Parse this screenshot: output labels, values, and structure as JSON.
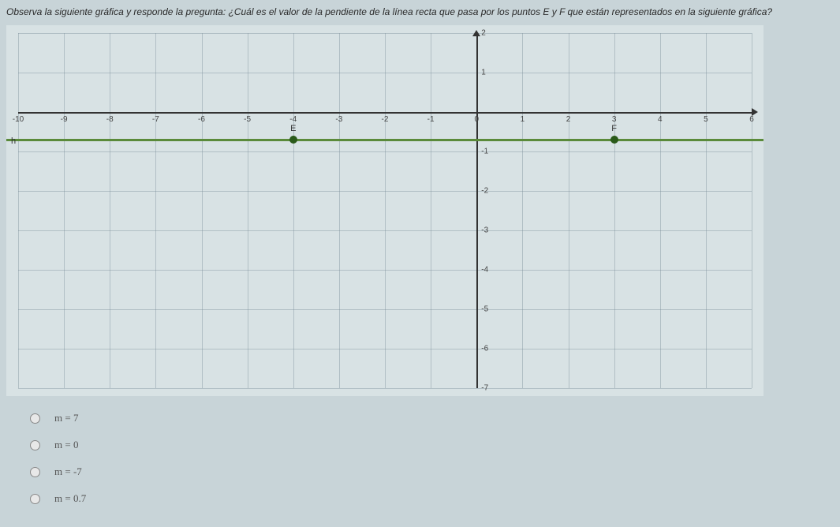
{
  "question": "Observa la siguiente gráfica y responde la pregunta: ¿Cuál es el valor de la pendiente de la línea recta que pasa por los puntos E y F que están representados en la siguiente gráfica?",
  "chart_data": {
    "type": "line",
    "title": "",
    "xlabel": "",
    "ylabel": "",
    "xlim": [
      -10,
      6
    ],
    "ylim": [
      -7,
      2
    ],
    "x_ticks": [
      -10,
      -9,
      -8,
      -7,
      -6,
      -5,
      -4,
      -3,
      -2,
      -1,
      0,
      1,
      2,
      3,
      4,
      5,
      6
    ],
    "y_ticks": [
      -7,
      -6,
      -5,
      -4,
      -3,
      -2,
      -1,
      0,
      1,
      2
    ],
    "points": [
      {
        "name": "E",
        "x": -4,
        "y": -0.7
      },
      {
        "name": "F",
        "x": 3,
        "y": -0.7
      }
    ],
    "line": {
      "name": "h",
      "y_value": -0.7,
      "type": "horizontal"
    },
    "grid": true
  },
  "options": [
    {
      "label": "m = 7",
      "value": "7"
    },
    {
      "label": "m = 0",
      "value": "0"
    },
    {
      "label": "m = -7",
      "value": "-7"
    },
    {
      "label": "m = 0.7",
      "value": "0.7"
    }
  ]
}
